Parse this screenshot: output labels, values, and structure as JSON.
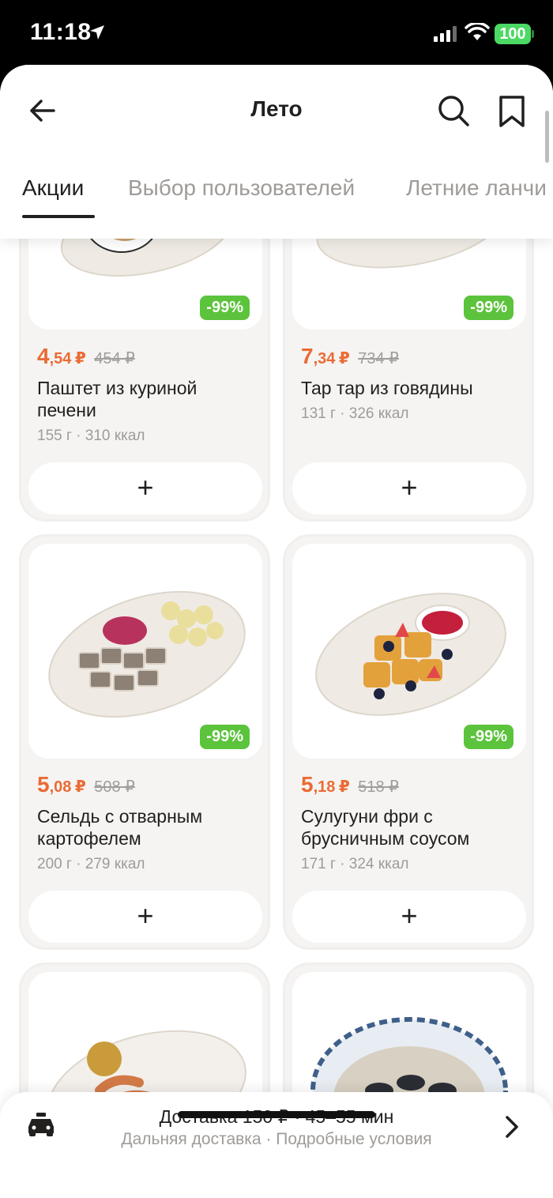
{
  "status": {
    "time": "11:18",
    "battery": "100"
  },
  "header": {
    "title": "Лето"
  },
  "tabs": [
    {
      "label": "Акции",
      "active": true
    },
    {
      "label": "Выбор пользователей",
      "active": false
    },
    {
      "label": "Летние ланчи",
      "active": false
    }
  ],
  "products": [
    {
      "name": "Паштет из куриной печени",
      "price_int": "4",
      "price_dec": ",54",
      "currency": "₽",
      "old_price": "454 ₽",
      "meta": "155 г · 310 ккал",
      "discount": "-99%",
      "add": "+"
    },
    {
      "name": "Тар тар из говядины",
      "price_int": "7",
      "price_dec": ",34",
      "currency": "₽",
      "old_price": "734 ₽",
      "meta": "131 г · 326 ккал",
      "discount": "-99%",
      "add": "+"
    },
    {
      "name": "Сельдь с отварным картофелем",
      "price_int": "5",
      "price_dec": ",08",
      "currency": "₽",
      "old_price": "508 ₽",
      "meta": "200 г · 279 ккал",
      "discount": "-99%",
      "add": "+"
    },
    {
      "name": "Сулугуни фри с брусничным соусом",
      "price_int": "5",
      "price_dec": ",18",
      "currency": "₽",
      "old_price": "518 ₽",
      "meta": "171 г · 324 ккал",
      "discount": "-99%",
      "add": "+"
    },
    {
      "name": "",
      "meta": ""
    },
    {
      "name": "",
      "meta": ""
    }
  ],
  "delivery": {
    "line1": "Доставка 150 ₽ · 45–55 мин",
    "line2": "Дальняя доставка · Подробные условия"
  },
  "colors": {
    "accent": "#ea6b35",
    "discount": "#5cc33d",
    "card_bg": "#f5f4f2"
  }
}
